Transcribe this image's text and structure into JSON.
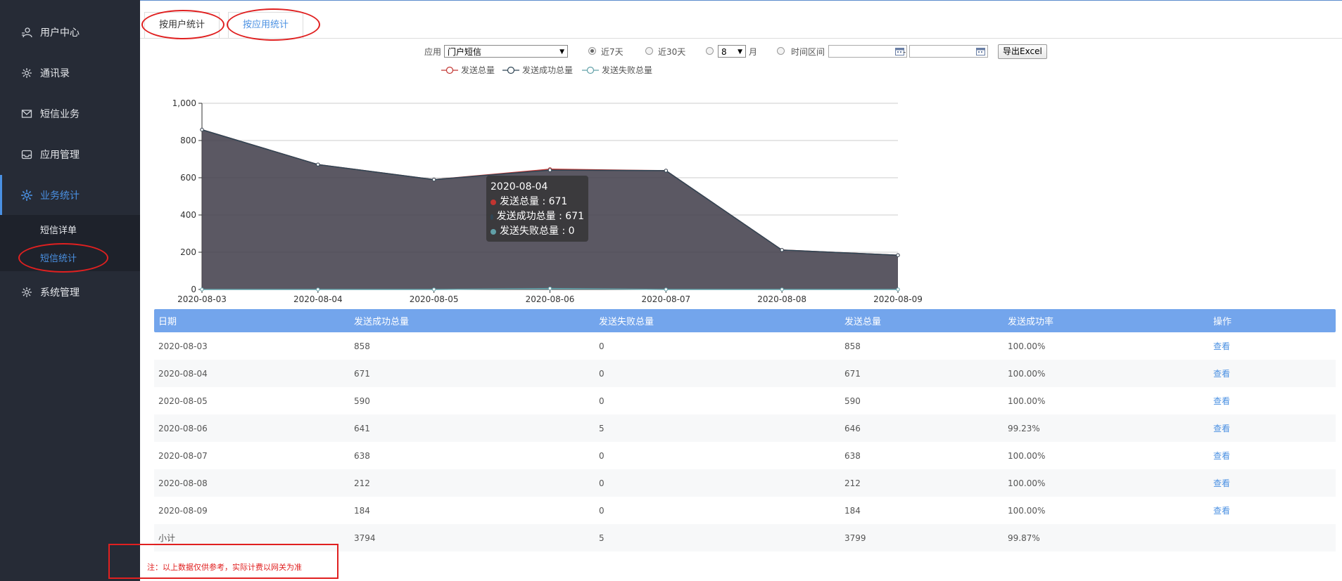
{
  "sidebar": {
    "items": [
      {
        "label": "用户中心",
        "icon": "user-center-icon"
      },
      {
        "label": "通讯录",
        "icon": "gear-icon"
      },
      {
        "label": "短信业务",
        "icon": "mail-icon"
      },
      {
        "label": "应用管理",
        "icon": "inbox-icon"
      },
      {
        "label": "业务统计",
        "icon": "gear-icon"
      },
      {
        "label": "系统管理",
        "icon": "gear-icon"
      }
    ],
    "sub_items": [
      {
        "label": "短信详单"
      },
      {
        "label": "短信统计"
      }
    ],
    "active_color": "#4a90e2",
    "background": "#262b36"
  },
  "tabs": [
    {
      "label": "按用户统计"
    },
    {
      "label": "按应用统计"
    }
  ],
  "filters": {
    "app_label": "应用",
    "app_value": "门户短信",
    "radio_7": "近7天",
    "radio_30": "近30天",
    "month_value": "8",
    "month_unit": "月",
    "range_label": "时间区间",
    "range_sep": "-",
    "export_label": "导出Excel"
  },
  "legend": [
    {
      "name": "发送总量",
      "color": "#c23531"
    },
    {
      "name": "发送成功总量",
      "color": "#2f4554"
    },
    {
      "name": "发送失败总量",
      "color": "#61a0a8"
    }
  ],
  "chart_data": {
    "type": "area",
    "x": [
      "2020-08-03",
      "2020-08-04",
      "2020-08-05",
      "2020-08-06",
      "2020-08-07",
      "2020-08-08",
      "2020-08-09"
    ],
    "ylim": [
      0,
      1000
    ],
    "yticks": [
      "0",
      "200",
      "400",
      "600",
      "800",
      "1,000"
    ],
    "grid": true,
    "legend_position": "top",
    "series": [
      {
        "name": "发送总量",
        "values": [
          858,
          671,
          590,
          646,
          638,
          212,
          184
        ]
      },
      {
        "name": "发送成功总量",
        "values": [
          858,
          671,
          590,
          641,
          638,
          212,
          184
        ]
      },
      {
        "name": "发送失败总量",
        "values": [
          0,
          0,
          0,
          5,
          0,
          0,
          0
        ]
      }
    ]
  },
  "tooltip": {
    "title": "2020-08-04",
    "rows": [
      "发送总量 : 671",
      "发送成功总量 : 671",
      "发送失败总量 : 0"
    ]
  },
  "table": {
    "headers": [
      "日期",
      "发送成功总量",
      "发送失败总量",
      "发送总量",
      "发送成功率",
      "操作"
    ],
    "rows": [
      [
        "2020-08-03",
        "858",
        "0",
        "858",
        "100.00%",
        "查看"
      ],
      [
        "2020-08-04",
        "671",
        "0",
        "671",
        "100.00%",
        "查看"
      ],
      [
        "2020-08-05",
        "590",
        "0",
        "590",
        "100.00%",
        "查看"
      ],
      [
        "2020-08-06",
        "641",
        "5",
        "646",
        "99.23%",
        "查看"
      ],
      [
        "2020-08-07",
        "638",
        "0",
        "638",
        "100.00%",
        "查看"
      ],
      [
        "2020-08-08",
        "212",
        "0",
        "212",
        "100.00%",
        "查看"
      ],
      [
        "2020-08-09",
        "184",
        "0",
        "184",
        "100.00%",
        "查看"
      ]
    ],
    "subtotal": [
      "小计",
      "3794",
      "5",
      "3799",
      "99.87%",
      ""
    ]
  },
  "note": "注：以上数据仅供参考，实际计费以网关为准"
}
